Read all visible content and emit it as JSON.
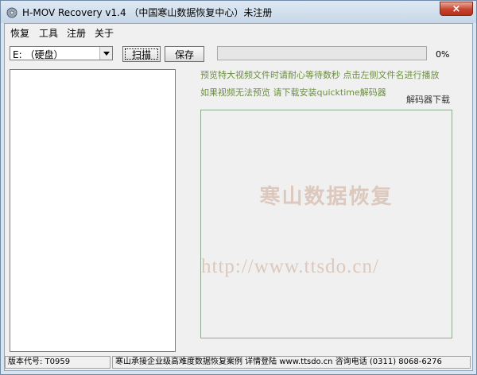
{
  "window": {
    "title": "H-MOV Recovery v1.4 （中国寒山数据恢复中心）未注册",
    "close_glyph": "×"
  },
  "menu": [
    {
      "label": "恢复"
    },
    {
      "label": "工具"
    },
    {
      "label": "注册"
    },
    {
      "label": "关于"
    }
  ],
  "toolbar": {
    "drive_value": "E: （硬盘）",
    "scan_label": "扫描",
    "save_label": "保存",
    "progress": 0,
    "progress_text": "0%"
  },
  "hints": {
    "line1": "预览特大视频文件时请耐心等待数秒 点击左侧文件名进行播放",
    "line2": "如果视频无法预览 请下载安装quicktime解码器",
    "codec_link": "解码器下载"
  },
  "preview": {
    "watermark_name": "寒山数据恢复",
    "watermark_url": "http://www.ttsdo.cn/"
  },
  "status": {
    "version": "版本代号: T0959",
    "info": "寒山承接企业级高难度数据恢复案例 详情登陆 www.ttsdo.cn 咨询电话 (0311) 8068-6276"
  },
  "colors": {
    "hint_text": "#6b8f3e",
    "watermark": "#dcc8bc",
    "progress_fill": "#3cb04a",
    "close_button": "#c7432d"
  },
  "icons": {
    "app": "disc-icon",
    "dropdown": "chevron-down-icon"
  }
}
